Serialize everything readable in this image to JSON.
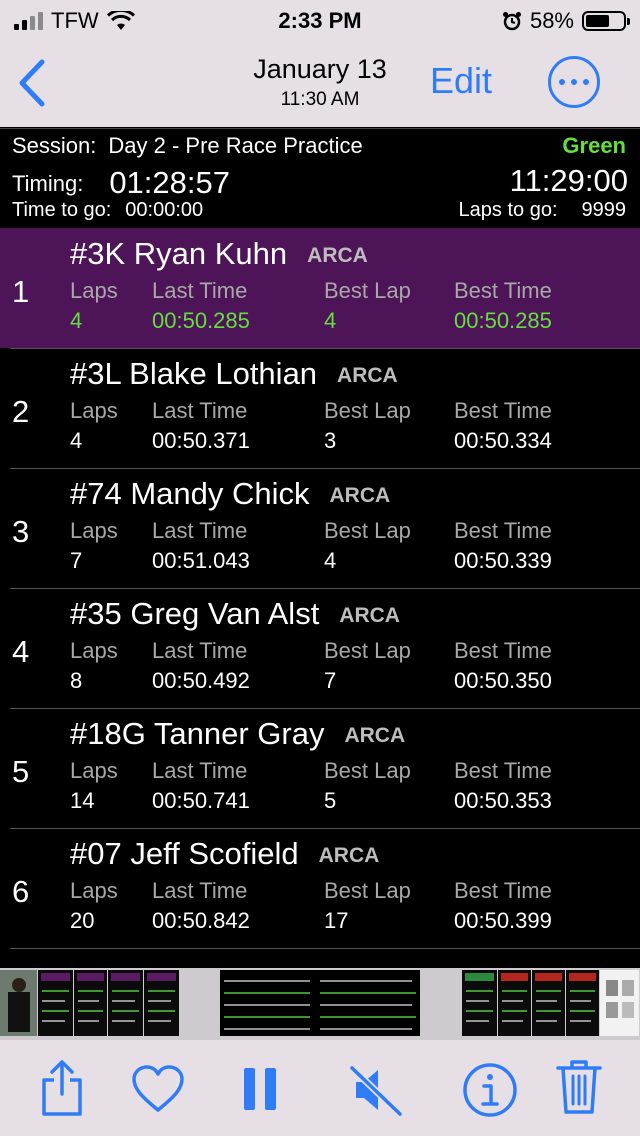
{
  "status": {
    "carrier": "TFW",
    "time": "2:33 PM",
    "battery": "58%"
  },
  "nav": {
    "date": "January 13",
    "time": "11:30 AM",
    "edit_label": "Edit"
  },
  "session": {
    "session_label": "Session:",
    "session_name": "Day 2 - Pre Race Practice",
    "flag": "Green",
    "timing_label": "Timing:",
    "timing": "01:28:57",
    "clock": "11:29:00",
    "ttg_label": "Time to go:",
    "ttg": "00:00:00",
    "lapsgo_label": "Laps to go:",
    "lapsgo": "9999"
  },
  "columns": {
    "laps": "Laps",
    "last": "Last Time",
    "bestlap": "Best Lap",
    "best": "Best Time"
  },
  "rows": [
    {
      "pos": "1",
      "name": "#3K Ryan Kuhn",
      "series": "ARCA",
      "laps": "4",
      "last": "00:50.285",
      "bestlap": "4",
      "best": "00:50.285"
    },
    {
      "pos": "2",
      "name": "#3L Blake Lothian",
      "series": "ARCA",
      "laps": "4",
      "last": "00:50.371",
      "bestlap": "3",
      "best": "00:50.334"
    },
    {
      "pos": "3",
      "name": "#74 Mandy Chick",
      "series": "ARCA",
      "laps": "7",
      "last": "00:51.043",
      "bestlap": "4",
      "best": "00:50.339"
    },
    {
      "pos": "4",
      "name": "#35 Greg Van Alst",
      "series": "ARCA",
      "laps": "8",
      "last": "00:50.492",
      "bestlap": "7",
      "best": "00:50.350"
    },
    {
      "pos": "5",
      "name": "#18G Tanner Gray",
      "series": "ARCA",
      "laps": "14",
      "last": "00:50.741",
      "bestlap": "5",
      "best": "00:50.353"
    },
    {
      "pos": "6",
      "name": "#07 Jeff Scofield",
      "series": "ARCA",
      "laps": "20",
      "last": "00:50.842",
      "bestlap": "17",
      "best": "00:50.399"
    }
  ],
  "icons": {
    "back": "chevron-left-icon",
    "more": "ellipsis-circle-icon",
    "share": "share-icon",
    "favorite": "heart-icon",
    "pause": "pause-icon",
    "mute": "speaker-muted-icon",
    "info": "info-icon",
    "delete": "trash-icon"
  },
  "colors": {
    "accent": "#2f7cf6",
    "leader_bg": "#4e1458",
    "green": "#62e03d"
  }
}
